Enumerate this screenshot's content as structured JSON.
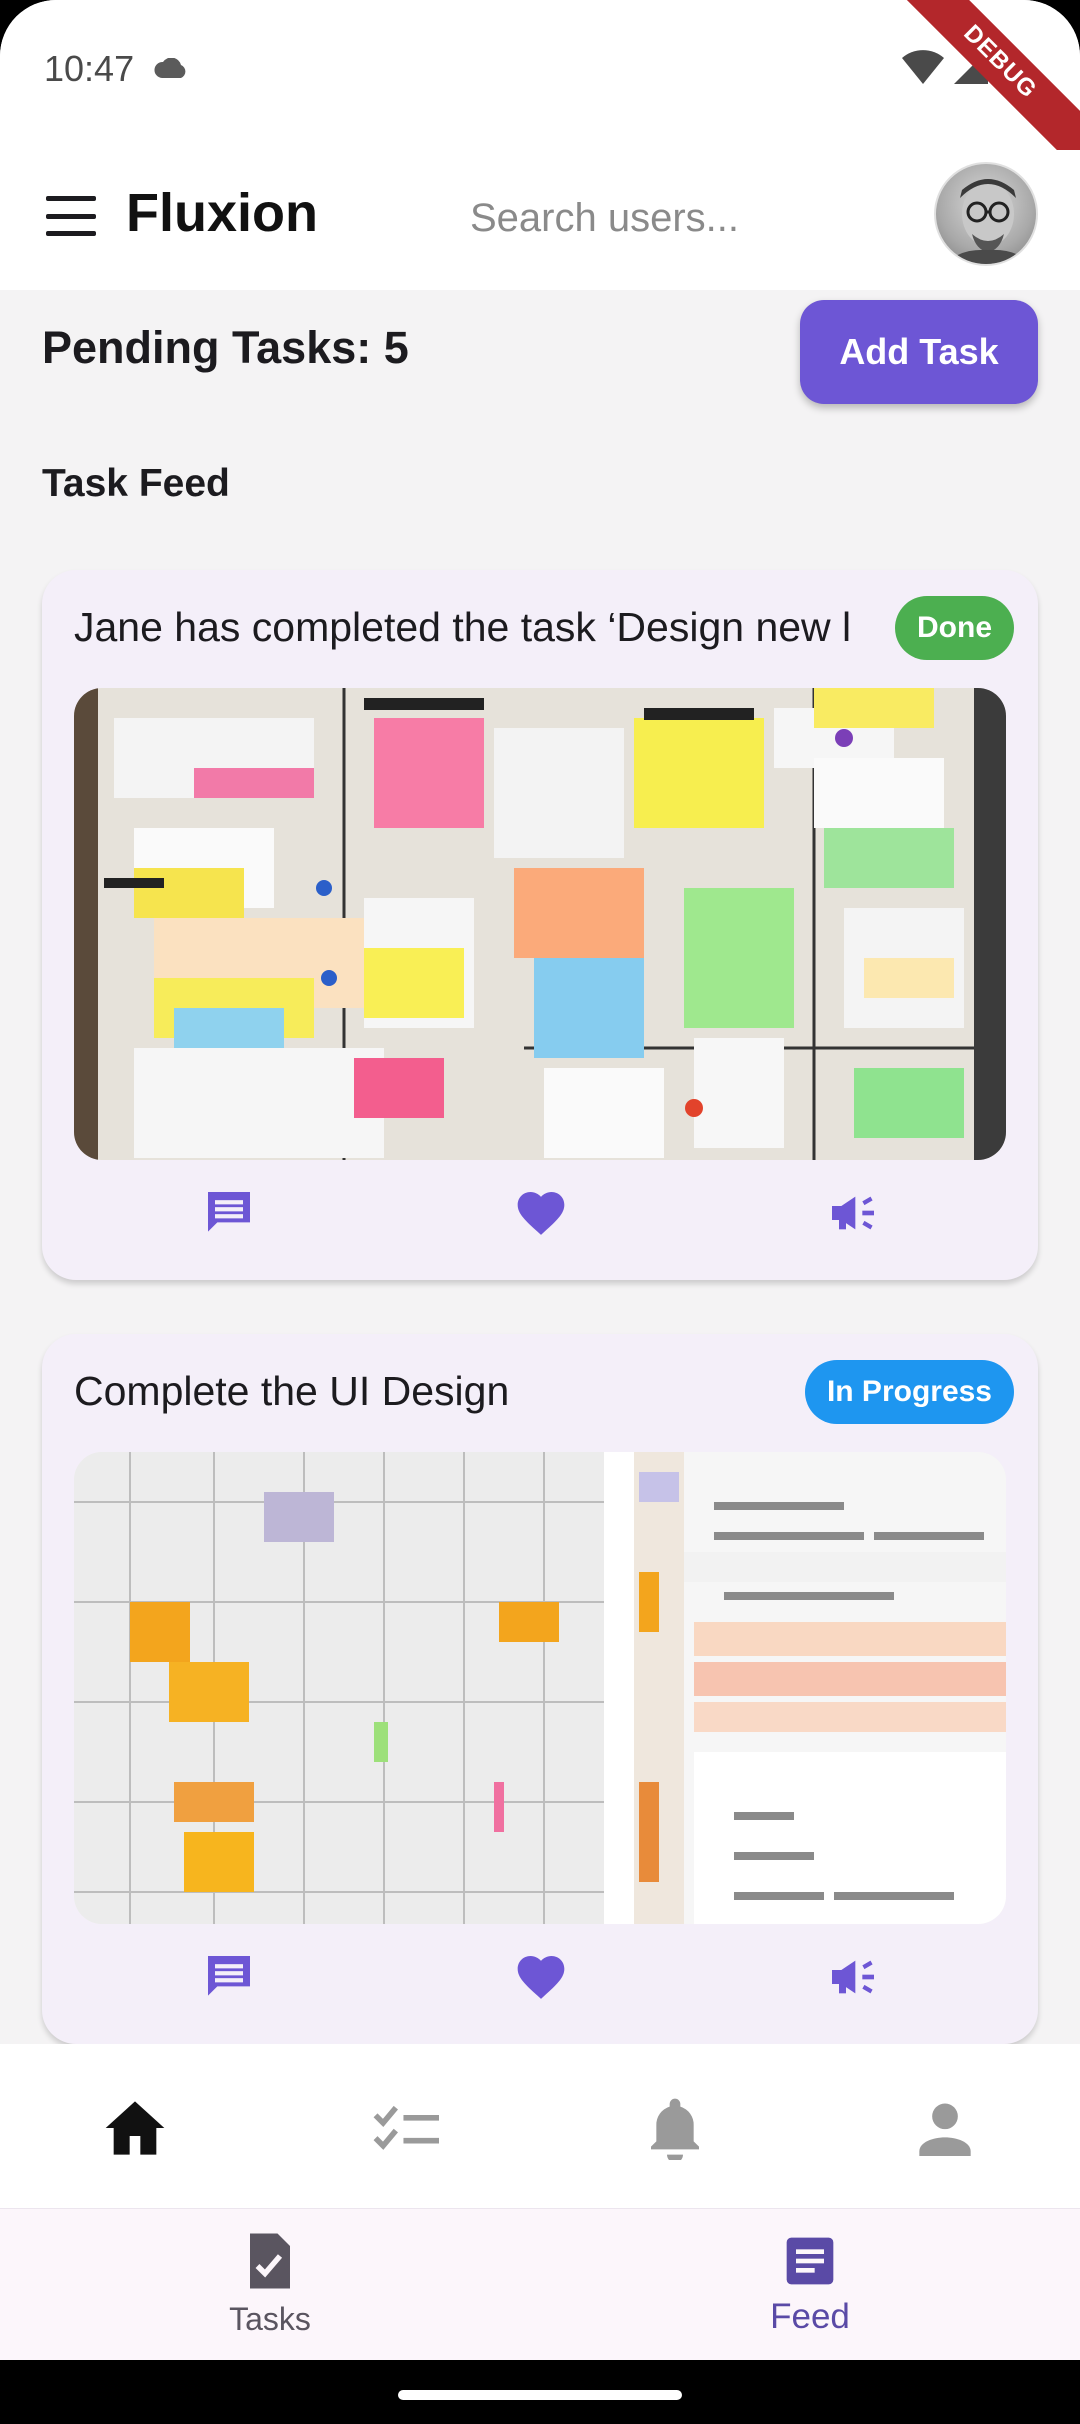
{
  "status_bar": {
    "time": "10:47",
    "debug_label": "DEBUG"
  },
  "app_bar": {
    "title": "Fluxion",
    "search_placeholder": "Search users..."
  },
  "summary": {
    "pending_label": "Pending Tasks: 5",
    "add_button": "Add Task"
  },
  "feed": {
    "title": "Task Feed",
    "cards": [
      {
        "text": "Jane has completed the task ‘Design new l",
        "status": "Done",
        "status_color": "#4caf50"
      },
      {
        "text": "Complete the UI Design",
        "status": "In Progress",
        "status_color": "#1e96f0"
      }
    ]
  },
  "icons": {
    "comment": "comment-icon",
    "like": "heart-icon",
    "share": "megaphone-icon",
    "home": "home-icon",
    "checklist": "checklist-icon",
    "bell": "bell-icon",
    "person": "person-icon"
  },
  "bottom_tabs": [
    {
      "label": "Tasks",
      "selected": false
    },
    {
      "label": "Feed",
      "selected": true
    }
  ],
  "colors": {
    "accent": "#6d56d5",
    "card_bg": "#f4eff9",
    "page_bg": "#f4f3f4"
  }
}
